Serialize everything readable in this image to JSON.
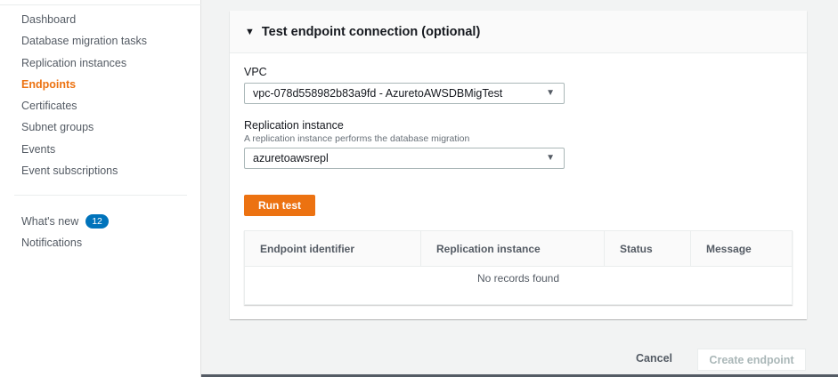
{
  "sidebar": {
    "items": [
      {
        "label": "Dashboard"
      },
      {
        "label": "Database migration tasks"
      },
      {
        "label": "Replication instances"
      },
      {
        "label": "Endpoints",
        "active": true
      },
      {
        "label": "Certificates"
      },
      {
        "label": "Subnet groups"
      },
      {
        "label": "Events"
      },
      {
        "label": "Event subscriptions"
      }
    ],
    "whats_new": "What's new",
    "whats_new_count": "12",
    "notifications": "Notifications"
  },
  "panel": {
    "title": "Test endpoint connection (optional)",
    "vpc_label": "VPC",
    "vpc_value": "vpc-078d558982b83a9fd - AzuretoAWSDBMigTest",
    "ri_label": "Replication instance",
    "ri_desc": "A replication instance performs the database migration",
    "ri_value": "azuretoawsrepl",
    "run_test": "Run test",
    "table": {
      "columns": [
        "Endpoint identifier",
        "Replication instance",
        "Status",
        "Message"
      ],
      "empty": "No records found"
    }
  },
  "footer": {
    "cancel": "Cancel",
    "create": "Create endpoint"
  }
}
